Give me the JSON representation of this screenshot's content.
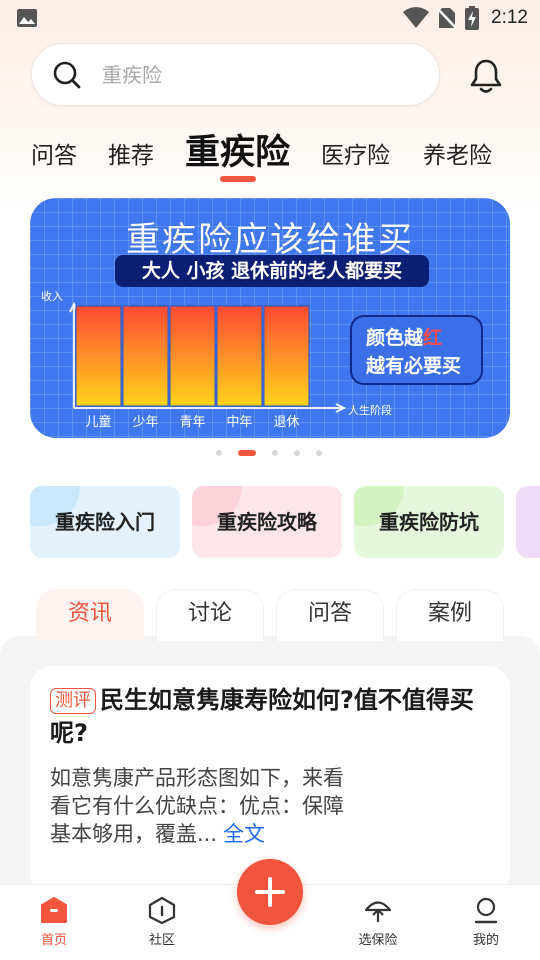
{
  "status_bar": {
    "time": "2:12"
  },
  "search": {
    "placeholder": "重疾险"
  },
  "tabs": [
    {
      "label": "问答"
    },
    {
      "label": "推荐"
    },
    {
      "label": "重疾险"
    },
    {
      "label": "医疗险"
    },
    {
      "label": "养老险"
    }
  ],
  "banner": {
    "title": "重疾险应该给谁买",
    "subtitle": "大人 小孩 退休前的老人都要买",
    "bubble_line1_prefix": "颜色越",
    "bubble_line1_highlight": "红",
    "bubble_line2": "越有必要买",
    "dot_count": 5,
    "active_dot": 1
  },
  "chart_data": {
    "type": "bar",
    "ylabel": "收入",
    "xlabel": "人生阶段",
    "categories": [
      "儿童",
      "少年",
      "青年",
      "中年",
      "退休"
    ],
    "values": [
      1,
      1,
      1,
      1,
      1
    ]
  },
  "categories": [
    {
      "label": "重疾险入门"
    },
    {
      "label": "重疾险攻略"
    },
    {
      "label": "重疾险防坑"
    },
    {
      "label": ""
    }
  ],
  "content_tabs": [
    {
      "label": "资讯"
    },
    {
      "label": "讨论"
    },
    {
      "label": "问答"
    },
    {
      "label": "案例"
    }
  ],
  "article": {
    "tag": "测评",
    "title": "民生如意隽康寿险如何?值不值得买呢?",
    "body": "如意隽康产品形态图如下，来看看它有什么优缺点：优点：保障基本够用，覆盖...",
    "more": "全文"
  },
  "bottom_nav": [
    {
      "label": "首页"
    },
    {
      "label": "社区"
    },
    {
      "label": "选保险"
    },
    {
      "label": "我的"
    }
  ],
  "colors": {
    "accent": "#f2553d",
    "banner_blue": "#3f78ee",
    "link": "#1e6af2"
  }
}
